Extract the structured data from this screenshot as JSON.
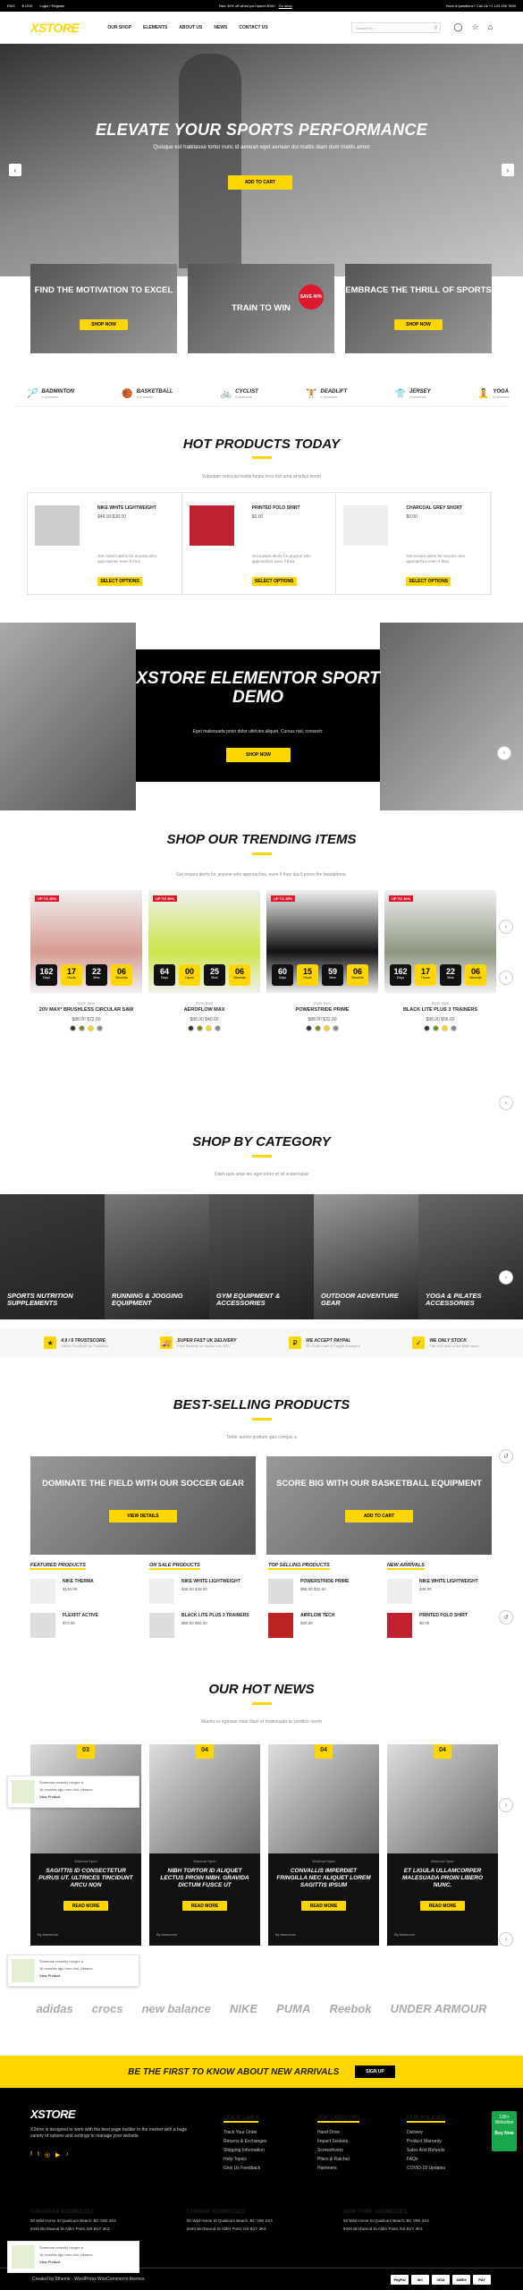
{
  "topbar": {
    "currency": "$ USD",
    "lang": "ENG",
    "login": "Login / Register",
    "promo": "Take 30% off when you spend $150",
    "promo_link": "Go shop",
    "help": "Have a questions? Call Us +1 123 456 7890"
  },
  "header": {
    "logo_main": "XSTORE",
    "nav": [
      "OUR SHOP",
      "ELEMENTS",
      "ABOUT US",
      "NEWS",
      "CONTACT US"
    ],
    "search_placeholder": "Search for..."
  },
  "hero": {
    "title": "ELEVATE YOUR SPORTS PERFORMANCE",
    "subtitle": "Quisque est habitasse tortor nunc id aenean eget aenean dui mattis diam dum mattis ames",
    "button": "ADD TO CART"
  },
  "promos": [
    {
      "title": "FIND THE MOTIVATION TO EXCEL",
      "button": "SHOP NOW"
    },
    {
      "title": "TRAIN TO WIN",
      "badge": "SAVE 40%"
    },
    {
      "title": "EMBRACE THE THRILL OF SPORTS",
      "button": "SHOP NOW"
    }
  ],
  "categories": [
    {
      "name": "BADMINTON",
      "count": "6 products",
      "icon": "shuttlecock-icon",
      "glyph": "🏸"
    },
    {
      "name": "BASKETBALL",
      "count": "6 products",
      "icon": "basketball-icon",
      "glyph": "🏀"
    },
    {
      "name": "CYCLIST",
      "count": "6 products",
      "icon": "bicycle-icon",
      "glyph": "🚲"
    },
    {
      "name": "DEADLIFT",
      "count": "6 products",
      "icon": "weightlifter-icon",
      "glyph": "🏋"
    },
    {
      "name": "JERSEY",
      "count": "6 products",
      "icon": "jersey-icon",
      "glyph": "👕"
    },
    {
      "name": "YOGA",
      "count": "6 products",
      "icon": "yoga-icon",
      "glyph": "🧘"
    }
  ],
  "hot": {
    "title": "HOT PRODUCTS TODAY",
    "subtitle": "Vulputate vehicula mattis turpis arcu nisl urna at tellus lorem",
    "items": [
      {
        "name": "NIKE WHITE LIGHTWEIGHT",
        "price": "$48.00  $38.00",
        "desc": "Get instant alerts for anyone who approaches even if they",
        "button": "SELECT OPTIONS"
      },
      {
        "name": "PRINTED POLO SHIRT",
        "price": "$0.00",
        "desc": "Get instant alerts for anyone who approaches even if they",
        "button": "SELECT OPTIONS"
      },
      {
        "name": "CHARCOAL GREY SHORT",
        "price": "$0.00",
        "desc": "Get instant alerts for anyone who approaches even if they",
        "button": "SELECT OPTIONS"
      }
    ]
  },
  "demo": {
    "title": "XSTORE ELEMENTOR SPORT DEMO",
    "subtitle": "Eget malesuada proin dolor ultricies aliquet. Cursus nisl, consectr.",
    "button": "SHOP NOW"
  },
  "trending": {
    "title": "SHOP OUR TRENDING ITEMS",
    "subtitle": "Get instant alerts for anyone who approaches, even if they don't press the headphone.",
    "items": [
      {
        "badge": "UP TO 30%",
        "cd": [
          "162",
          "17",
          "22",
          "06"
        ],
        "cat": "Gym tops",
        "name": "20V MAX* BRUSHLESS CIRCULAR SAW",
        "price": "$88.00  $72.00"
      },
      {
        "badge": "UP TO 50%",
        "cd": [
          "64",
          "00",
          "25",
          "06"
        ],
        "cat": "Gym tops",
        "name": "AEROFLOW MAX",
        "price": "$88.00  $40.00"
      },
      {
        "badge": "UP TO 35%",
        "cd": [
          "60",
          "15",
          "59",
          "06"
        ],
        "cat": "Gym tops",
        "name": "POWERSTRIDE PRIME",
        "price": "$88.00  $32.00"
      },
      {
        "badge": "UP TO 30%",
        "cd": [
          "162",
          "17",
          "22",
          "06"
        ],
        "cat": "Gym tops",
        "name": "BLACK LITE PLUS 3 TRAINERS",
        "price": "$88.00  $56.00"
      }
    ],
    "cd_labels": [
      "Days",
      "Hours",
      "Mins",
      "Seconds"
    ]
  },
  "shop_by_cat": {
    "title": "SHOP BY CATEGORY",
    "subtitle": "Diam quis vitae leo eget tortor et sit scelerisque",
    "items": [
      "SPORTS NUTRITION SUPPLEMENTS",
      "RUNNING & JOGGING EQUIPMENT",
      "GYM EQUIPMENT & ACCESSORIES",
      "OUTDOOR ADVENTURE GEAR",
      "YOGA & PILATES ACCESSORIES"
    ]
  },
  "trust": [
    {
      "title": "4.9 / 5 TRUSTSCORE",
      "sub": "Rated 'Excellent' on Trustpilot"
    },
    {
      "title": "SUPER FAST UK DELIVERY",
      "sub": "Free Delivery on orders over $20"
    },
    {
      "title": "WE ACCEPT PAYPAL",
      "sub": "30 Credit Card & Paypal Accepted"
    },
    {
      "title": "WE ONLY STOCK",
      "sub": "The very best of the best brand"
    }
  ],
  "bestselling": {
    "title": "BEST-SELLING PRODUCTS",
    "subtitle": "Tortor auctor pretium quis congue a",
    "banners": [
      {
        "title": "DOMINATE THE FIELD WITH OUR SOCCER GEAR",
        "button": "VIEW DETAILS"
      },
      {
        "title": "SCORE BIG WITH OUR BASKETBALL EQUIPMENT",
        "button": "ADD TO CART"
      }
    ],
    "cols": [
      {
        "heading": "FEATURED PRODUCTS",
        "items": [
          {
            "name": "NIKE THERMA",
            "price": "$120.00"
          },
          {
            "name": "FLEXFIT ACTIVE",
            "price": "$73.00"
          }
        ]
      },
      {
        "heading": "ON SALE PRODUCTS",
        "items": [
          {
            "name": "NIKE WHITE LIGHTWEIGHT",
            "price": "$48.00  $38.00"
          },
          {
            "name": "BLACK LITE PLUS 3 TRAINERS",
            "price": "$88.00  $56.00"
          }
        ]
      },
      {
        "heading": "TOP SELLING PRODUCTS",
        "items": [
          {
            "name": "POWERSTRIDE PRIME",
            "price": "$88.00  $32.00"
          },
          {
            "name": "AIRFLOW TECH",
            "price": "$20.00"
          }
        ]
      },
      {
        "heading": "NEW ARRIVALS",
        "items": [
          {
            "name": "NIKE WHITE LIGHTWEIGHT",
            "price": "$48.00"
          },
          {
            "name": "PRINTED POLO SHIRT",
            "price": "$0.00"
          }
        ]
      }
    ]
  },
  "news": {
    "title": "OUR HOT NEWS",
    "subtitle": "Mauris ex egestas vitae diam et malesuada ac porttitor lorem",
    "tags": "Workout  Sport",
    "button": "READ MORE",
    "by": "By Awesome",
    "items": [
      {
        "date": "03",
        "title": "SAGITTIS ID CONSECTETUR PURUS UT. ULTRICES TINCIDUNT ARCU NON"
      },
      {
        "date": "04",
        "title": "NIBH TORTOR ID ALIQUET LECTUS PROIN NIBH. GRAVIDA DICTUM FUSCE UT"
      },
      {
        "date": "04",
        "title": "CONVALLIS IMPERDIET FRINGILLA NEC ALIQUET LOREM SAGITTIS IPSUM"
      },
      {
        "date": "04",
        "title": "ET LIGULA ULLAMCORPER MALESUADA PROIN LIBERO NUNC."
      }
    ]
  },
  "toast": {
    "line1": "Someone recently bought a",
    "line2": "16 minutes ago from Hai, Ukraine",
    "line3": "View Product"
  },
  "brands": [
    "adidas",
    "crocs",
    "new balance",
    "NIKE",
    "PUMA",
    "Reebok",
    "UNDER ARMOUR"
  ],
  "newsletter": {
    "title": "BE THE FIRST TO KNOW ABOUT NEW ARRIVALS",
    "button": "SIGN UP"
  },
  "footer": {
    "logo": "XSTORE",
    "about": "XStore is designed to work with the best page builder in the market with a huge variety of options and settings to manage your website.",
    "quick_h": "QUICK LINKS",
    "quick": [
      "Track Your Order",
      "Returns & Exchanges",
      "Shipping Information",
      "Help Topics",
      "Give Us Feedback"
    ],
    "top_h": "TOP CATEGORY",
    "top": [
      "Hand Drive",
      "Impact Sockets",
      "Screwdrivers",
      "Pliers & Ratchet",
      "Hammers"
    ],
    "pol_h": "OUR POLICIES",
    "pol": [
      "Delivery",
      "Product Warranty",
      "Sales And Refunds",
      "FAQs",
      "COVID-19 Updates"
    ],
    "addrs": [
      {
        "h": "CANADIAN ADDRESSES:",
        "l1": "50 Wild Horse St Qualicum Beach, BC V9K 2S4",
        "l2": "9440 Birchwood St Alder Point, NS B1Y 3K3"
      },
      {
        "h": "LONDON ADDRESSES:",
        "l1": "50 Wild Horse St Qualicum Beach, BC V9K 2S4",
        "l2": "9440 Birchwood St Alder Point, NS B1Y 3K3"
      },
      {
        "h": "NEW YORK ADDRESSES:",
        "l1": "50 Wild Horse St Qualicum Beach, BC V9K 2S4",
        "l2": "9440 Birchwood St Alder Point, NS B1Y 3K3"
      }
    ],
    "copy": "Created by 8theme - WordPress WooCommerce themes.",
    "pay": [
      "PayPal",
      "MC",
      "VISA",
      "AMEX",
      "PAY"
    ],
    "badge": "130+ Websites",
    "buy": "Buy Now"
  },
  "colors": {
    "accent": "#ffd600",
    "sale": "#e0182d"
  }
}
